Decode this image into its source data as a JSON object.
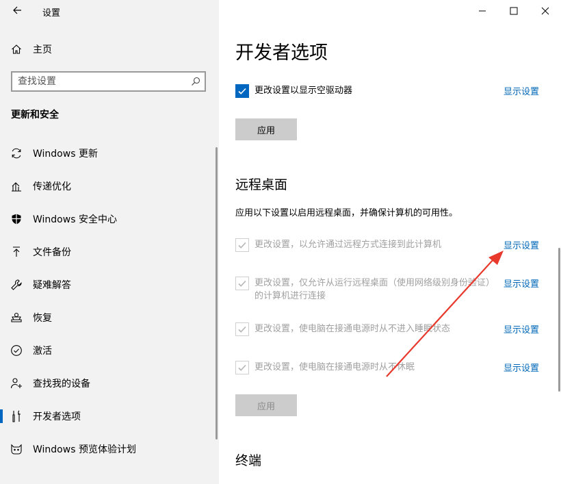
{
  "sidebar": {
    "app_title": "设置",
    "home_label": "主页",
    "search_placeholder": "查找设置",
    "section_title": "更新和安全",
    "items": [
      {
        "label": "Windows 更新",
        "icon": "sync-icon"
      },
      {
        "label": "传递优化",
        "icon": "delivery-icon"
      },
      {
        "label": "Windows 安全中心",
        "icon": "shield-icon"
      },
      {
        "label": "文件备份",
        "icon": "backup-upload-icon"
      },
      {
        "label": "疑难解答",
        "icon": "wrench-icon"
      },
      {
        "label": "恢复",
        "icon": "recovery-icon"
      },
      {
        "label": "激活",
        "icon": "check-circle-icon"
      },
      {
        "label": "查找我的设备",
        "icon": "person-location-icon"
      },
      {
        "label": "开发者选项",
        "icon": "developer-tools-icon",
        "active": true
      },
      {
        "label": "Windows 预览体验计划",
        "icon": "insider-cat-icon"
      }
    ]
  },
  "main": {
    "title": "开发者选项",
    "top_setting": {
      "label": "更改设置以显示空驱动器",
      "checked": true,
      "link": "显示设置"
    },
    "apply_label": "应用",
    "remote": {
      "heading": "远程桌面",
      "description": "应用以下设置以启用远程桌面，并确保计算机的可用性。",
      "settings": [
        {
          "label": "更改设置，以允许通过远程方式连接到此计算机",
          "link": "显示设置"
        },
        {
          "label": "更改设置，仅允许从运行远程桌面（使用网络级别身份验证）的计算机进行连接",
          "link": "显示设置"
        },
        {
          "label": "更改设置，使电脑在接通电源时从不进入睡眠状态",
          "link": "显示设置"
        },
        {
          "label": "更改设置，使电脑在接通电源时从不休眠",
          "link": "显示设置"
        }
      ],
      "apply_label": "应用"
    },
    "terminal_heading": "终端"
  },
  "window_controls": [
    "minimize-icon",
    "maximize-icon",
    "close-icon"
  ],
  "colors": {
    "accent": "#0067c0",
    "link": "#0067b8",
    "annotation_arrow": "#e8392c",
    "sidebar_bg": "#f2f2f2"
  }
}
